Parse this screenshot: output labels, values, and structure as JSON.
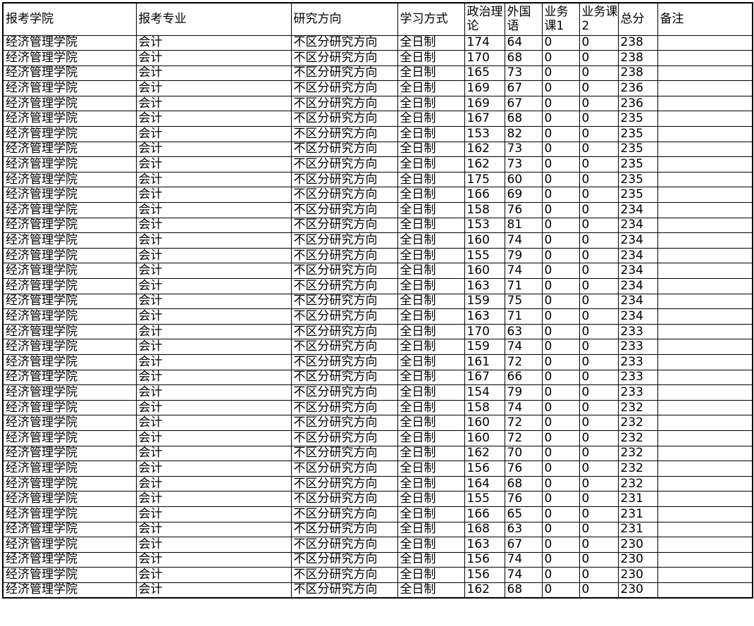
{
  "headers": [
    "报考学院",
    "报考专业",
    "研究方向",
    "学习方式",
    "政治理论",
    "外国语",
    "业务课1",
    "业务课2",
    "总分",
    "备注"
  ],
  "rows": [
    [
      "经济管理学院",
      "会计",
      "不区分研究方向",
      "全日制",
      "174",
      "64",
      "0",
      "0",
      "238",
      ""
    ],
    [
      "经济管理学院",
      "会计",
      "不区分研究方向",
      "全日制",
      "170",
      "68",
      "0",
      "0",
      "238",
      ""
    ],
    [
      "经济管理学院",
      "会计",
      "不区分研究方向",
      "全日制",
      "165",
      "73",
      "0",
      "0",
      "238",
      ""
    ],
    [
      "经济管理学院",
      "会计",
      "不区分研究方向",
      "全日制",
      "169",
      "67",
      "0",
      "0",
      "236",
      ""
    ],
    [
      "经济管理学院",
      "会计",
      "不区分研究方向",
      "全日制",
      "169",
      "67",
      "0",
      "0",
      "236",
      ""
    ],
    [
      "经济管理学院",
      "会计",
      "不区分研究方向",
      "全日制",
      "167",
      "68",
      "0",
      "0",
      "235",
      ""
    ],
    [
      "经济管理学院",
      "会计",
      "不区分研究方向",
      "全日制",
      "153",
      "82",
      "0",
      "0",
      "235",
      ""
    ],
    [
      "经济管理学院",
      "会计",
      "不区分研究方向",
      "全日制",
      "162",
      "73",
      "0",
      "0",
      "235",
      ""
    ],
    [
      "经济管理学院",
      "会计",
      "不区分研究方向",
      "全日制",
      "162",
      "73",
      "0",
      "0",
      "235",
      ""
    ],
    [
      "经济管理学院",
      "会计",
      "不区分研究方向",
      "全日制",
      "175",
      "60",
      "0",
      "0",
      "235",
      ""
    ],
    [
      "经济管理学院",
      "会计",
      "不区分研究方向",
      "全日制",
      "166",
      "69",
      "0",
      "0",
      "235",
      ""
    ],
    [
      "经济管理学院",
      "会计",
      "不区分研究方向",
      "全日制",
      "158",
      "76",
      "0",
      "0",
      "234",
      ""
    ],
    [
      "经济管理学院",
      "会计",
      "不区分研究方向",
      "全日制",
      "153",
      "81",
      "0",
      "0",
      "234",
      ""
    ],
    [
      "经济管理学院",
      "会计",
      "不区分研究方向",
      "全日制",
      "160",
      "74",
      "0",
      "0",
      "234",
      ""
    ],
    [
      "经济管理学院",
      "会计",
      "不区分研究方向",
      "全日制",
      "155",
      "79",
      "0",
      "0",
      "234",
      ""
    ],
    [
      "经济管理学院",
      "会计",
      "不区分研究方向",
      "全日制",
      "160",
      "74",
      "0",
      "0",
      "234",
      ""
    ],
    [
      "经济管理学院",
      "会计",
      "不区分研究方向",
      "全日制",
      "163",
      "71",
      "0",
      "0",
      "234",
      ""
    ],
    [
      "经济管理学院",
      "会计",
      "不区分研究方向",
      "全日制",
      "159",
      "75",
      "0",
      "0",
      "234",
      ""
    ],
    [
      "经济管理学院",
      "会计",
      "不区分研究方向",
      "全日制",
      "163",
      "71",
      "0",
      "0",
      "234",
      ""
    ],
    [
      "经济管理学院",
      "会计",
      "不区分研究方向",
      "全日制",
      "170",
      "63",
      "0",
      "0",
      "233",
      ""
    ],
    [
      "经济管理学院",
      "会计",
      "不区分研究方向",
      "全日制",
      "159",
      "74",
      "0",
      "0",
      "233",
      ""
    ],
    [
      "经济管理学院",
      "会计",
      "不区分研究方向",
      "全日制",
      "161",
      "72",
      "0",
      "0",
      "233",
      ""
    ],
    [
      "经济管理学院",
      "会计",
      "不区分研究方向",
      "全日制",
      "167",
      "66",
      "0",
      "0",
      "233",
      ""
    ],
    [
      "经济管理学院",
      "会计",
      "不区分研究方向",
      "全日制",
      "154",
      "79",
      "0",
      "0",
      "233",
      ""
    ],
    [
      "经济管理学院",
      "会计",
      "不区分研究方向",
      "全日制",
      "158",
      "74",
      "0",
      "0",
      "232",
      ""
    ],
    [
      "经济管理学院",
      "会计",
      "不区分研究方向",
      "全日制",
      "160",
      "72",
      "0",
      "0",
      "232",
      ""
    ],
    [
      "经济管理学院",
      "会计",
      "不区分研究方向",
      "全日制",
      "160",
      "72",
      "0",
      "0",
      "232",
      ""
    ],
    [
      "经济管理学院",
      "会计",
      "不区分研究方向",
      "全日制",
      "162",
      "70",
      "0",
      "0",
      "232",
      ""
    ],
    [
      "经济管理学院",
      "会计",
      "不区分研究方向",
      "全日制",
      "156",
      "76",
      "0",
      "0",
      "232",
      ""
    ],
    [
      "经济管理学院",
      "会计",
      "不区分研究方向",
      "全日制",
      "164",
      "68",
      "0",
      "0",
      "232",
      ""
    ],
    [
      "经济管理学院",
      "会计",
      "不区分研究方向",
      "全日制",
      "155",
      "76",
      "0",
      "0",
      "231",
      ""
    ],
    [
      "经济管理学院",
      "会计",
      "不区分研究方向",
      "全日制",
      "166",
      "65",
      "0",
      "0",
      "231",
      ""
    ],
    [
      "经济管理学院",
      "会计",
      "不区分研究方向",
      "全日制",
      "168",
      "63",
      "0",
      "0",
      "231",
      ""
    ],
    [
      "经济管理学院",
      "会计",
      "不区分研究方向",
      "全日制",
      "163",
      "67",
      "0",
      "0",
      "230",
      ""
    ],
    [
      "经济管理学院",
      "会计",
      "不区分研究方向",
      "全日制",
      "156",
      "74",
      "0",
      "0",
      "230",
      ""
    ],
    [
      "经济管理学院",
      "会计",
      "不区分研究方向",
      "全日制",
      "156",
      "74",
      "0",
      "0",
      "230",
      ""
    ],
    [
      "经济管理学院",
      "会计",
      "不区分研究方向",
      "全日制",
      "162",
      "68",
      "0",
      "0",
      "230",
      ""
    ]
  ]
}
